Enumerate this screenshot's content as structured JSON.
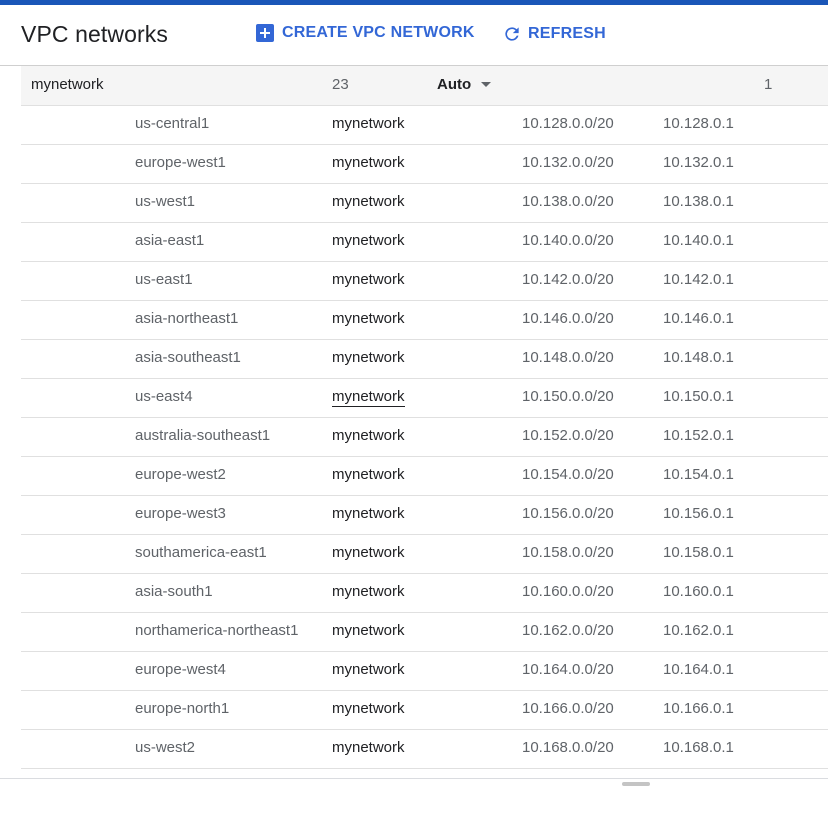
{
  "header": {
    "title": "VPC networks",
    "create_label": "CREATE VPC NETWORK",
    "refresh_label": "REFRESH",
    "create_icon": "add-box-icon",
    "refresh_icon": "refresh-icon",
    "accent": "#3367d6",
    "topbar_color": "#1a56b8"
  },
  "network": {
    "name": "mynetwork",
    "subnet_count": "23",
    "mode": "Auto",
    "mode_icon": "caret-down-icon",
    "value_one": "1"
  },
  "subnets": [
    {
      "region": "us-central1",
      "network": "mynetwork",
      "range": "10.128.0.0/20",
      "gateway": "10.128.0.1"
    },
    {
      "region": "europe-west1",
      "network": "mynetwork",
      "range": "10.132.0.0/20",
      "gateway": "10.132.0.1"
    },
    {
      "region": "us-west1",
      "network": "mynetwork",
      "range": "10.138.0.0/20",
      "gateway": "10.138.0.1"
    },
    {
      "region": "asia-east1",
      "network": "mynetwork",
      "range": "10.140.0.0/20",
      "gateway": "10.140.0.1"
    },
    {
      "region": "us-east1",
      "network": "mynetwork",
      "range": "10.142.0.0/20",
      "gateway": "10.142.0.1"
    },
    {
      "region": "asia-northeast1",
      "network": "mynetwork",
      "range": "10.146.0.0/20",
      "gateway": "10.146.0.1"
    },
    {
      "region": "asia-southeast1",
      "network": "mynetwork",
      "range": "10.148.0.0/20",
      "gateway": "10.148.0.1"
    },
    {
      "region": "us-east4",
      "network": "mynetwork",
      "range": "10.150.0.0/20",
      "gateway": "10.150.0.1"
    },
    {
      "region": "australia-southeast1",
      "network": "mynetwork",
      "range": "10.152.0.0/20",
      "gateway": "10.152.0.1"
    },
    {
      "region": "europe-west2",
      "network": "mynetwork",
      "range": "10.154.0.0/20",
      "gateway": "10.154.0.1"
    },
    {
      "region": "europe-west3",
      "network": "mynetwork",
      "range": "10.156.0.0/20",
      "gateway": "10.156.0.1"
    },
    {
      "region": "southamerica-east1",
      "network": "mynetwork",
      "range": "10.158.0.0/20",
      "gateway": "10.158.0.1"
    },
    {
      "region": "asia-south1",
      "network": "mynetwork",
      "range": "10.160.0.0/20",
      "gateway": "10.160.0.1"
    },
    {
      "region": "northamerica-northeast1",
      "network": "mynetwork",
      "range": "10.162.0.0/20",
      "gateway": "10.162.0.1"
    },
    {
      "region": "europe-west4",
      "network": "mynetwork",
      "range": "10.164.0.0/20",
      "gateway": "10.164.0.1"
    },
    {
      "region": "europe-north1",
      "network": "mynetwork",
      "range": "10.166.0.0/20",
      "gateway": "10.166.0.1"
    },
    {
      "region": "us-west2",
      "network": "mynetwork",
      "range": "10.168.0.0/20",
      "gateway": "10.168.0.1"
    }
  ]
}
